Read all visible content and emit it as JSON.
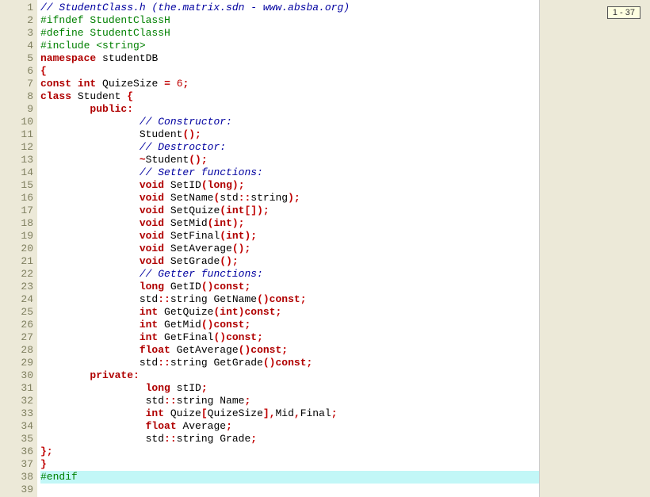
{
  "badge": "1 - 37",
  "lines": [
    {
      "n": 1,
      "hl": false,
      "tokens": [
        [
          "c-comment",
          "// StudentClass.h (the.matrix.sdn - www.absba.org)"
        ]
      ]
    },
    {
      "n": 2,
      "hl": false,
      "tokens": [
        [
          "c-pre",
          "#ifndef StudentClassH"
        ]
      ]
    },
    {
      "n": 3,
      "hl": false,
      "tokens": [
        [
          "c-pre",
          "#define StudentClassH"
        ]
      ]
    },
    {
      "n": 4,
      "hl": false,
      "tokens": [
        [
          "c-pre",
          "#include <string>"
        ]
      ]
    },
    {
      "n": 5,
      "hl": false,
      "tokens": [
        [
          "c-kw",
          "namespace"
        ],
        [
          "",
          " "
        ],
        [
          "c-ident",
          "studentDB"
        ]
      ]
    },
    {
      "n": 6,
      "hl": false,
      "tokens": [
        [
          "c-punct",
          "{"
        ]
      ]
    },
    {
      "n": 7,
      "hl": false,
      "tokens": [
        [
          "c-kw",
          "const"
        ],
        [
          "",
          " "
        ],
        [
          "c-kw",
          "int"
        ],
        [
          "",
          " QuizeSize "
        ],
        [
          "c-punct",
          "="
        ],
        [
          "",
          " "
        ],
        [
          "c-num",
          "6"
        ],
        [
          "c-punct",
          ";"
        ]
      ]
    },
    {
      "n": 8,
      "hl": false,
      "tokens": [
        [
          "c-kw",
          "class"
        ],
        [
          "",
          " Student "
        ],
        [
          "c-punct",
          "{"
        ]
      ]
    },
    {
      "n": 9,
      "hl": false,
      "tokens": [
        [
          "",
          "        "
        ],
        [
          "c-kw",
          "public"
        ],
        [
          "c-punct",
          ":"
        ]
      ]
    },
    {
      "n": 10,
      "hl": false,
      "tokens": [
        [
          "",
          "                "
        ],
        [
          "c-comment",
          "// Constructor:"
        ]
      ]
    },
    {
      "n": 11,
      "hl": false,
      "tokens": [
        [
          "",
          "                Student"
        ],
        [
          "c-punct",
          "();"
        ]
      ]
    },
    {
      "n": 12,
      "hl": false,
      "tokens": [
        [
          "",
          "                "
        ],
        [
          "c-comment",
          "// Destroctor:"
        ]
      ]
    },
    {
      "n": 13,
      "hl": false,
      "tokens": [
        [
          "",
          "                "
        ],
        [
          "c-punct",
          "~"
        ],
        [
          "",
          "Student"
        ],
        [
          "c-punct",
          "();"
        ]
      ]
    },
    {
      "n": 14,
      "hl": false,
      "tokens": [
        [
          "",
          "                "
        ],
        [
          "c-comment",
          "// Setter functions:"
        ]
      ]
    },
    {
      "n": 15,
      "hl": false,
      "tokens": [
        [
          "",
          "                "
        ],
        [
          "c-kw",
          "void"
        ],
        [
          "",
          " SetID"
        ],
        [
          "c-punct",
          "("
        ],
        [
          "c-kw",
          "long"
        ],
        [
          "c-punct",
          ");"
        ]
      ]
    },
    {
      "n": 16,
      "hl": false,
      "tokens": [
        [
          "",
          "                "
        ],
        [
          "c-kw",
          "void"
        ],
        [
          "",
          " SetName"
        ],
        [
          "c-punct",
          "("
        ],
        [
          "",
          "std"
        ],
        [
          "c-punct",
          "::"
        ],
        [
          "",
          "string"
        ],
        [
          "c-punct",
          ");"
        ]
      ]
    },
    {
      "n": 17,
      "hl": false,
      "tokens": [
        [
          "",
          "                "
        ],
        [
          "c-kw",
          "void"
        ],
        [
          "",
          " SetQuize"
        ],
        [
          "c-punct",
          "("
        ],
        [
          "c-kw",
          "int"
        ],
        [
          "c-punct",
          "[]);"
        ]
      ]
    },
    {
      "n": 18,
      "hl": false,
      "tokens": [
        [
          "",
          "                "
        ],
        [
          "c-kw",
          "void"
        ],
        [
          "",
          " SetMid"
        ],
        [
          "c-punct",
          "("
        ],
        [
          "c-kw",
          "int"
        ],
        [
          "c-punct",
          ");"
        ]
      ]
    },
    {
      "n": 19,
      "hl": false,
      "tokens": [
        [
          "",
          "                "
        ],
        [
          "c-kw",
          "void"
        ],
        [
          "",
          " SetFinal"
        ],
        [
          "c-punct",
          "("
        ],
        [
          "c-kw",
          "int"
        ],
        [
          "c-punct",
          ");"
        ]
      ]
    },
    {
      "n": 20,
      "hl": false,
      "tokens": [
        [
          "",
          "                "
        ],
        [
          "c-kw",
          "void"
        ],
        [
          "",
          " SetAverage"
        ],
        [
          "c-punct",
          "();"
        ]
      ]
    },
    {
      "n": 21,
      "hl": false,
      "tokens": [
        [
          "",
          "                "
        ],
        [
          "c-kw",
          "void"
        ],
        [
          "",
          " SetGrade"
        ],
        [
          "c-punct",
          "();"
        ]
      ]
    },
    {
      "n": 22,
      "hl": false,
      "tokens": [
        [
          "",
          "                "
        ],
        [
          "c-comment",
          "// Getter functions:"
        ]
      ]
    },
    {
      "n": 23,
      "hl": false,
      "tokens": [
        [
          "",
          "                "
        ],
        [
          "c-kw",
          "long"
        ],
        [
          "",
          " GetID"
        ],
        [
          "c-punct",
          "()"
        ],
        [
          "c-kw",
          "const"
        ],
        [
          "c-punct",
          ";"
        ]
      ]
    },
    {
      "n": 24,
      "hl": false,
      "tokens": [
        [
          "",
          "                std"
        ],
        [
          "c-punct",
          "::"
        ],
        [
          "",
          "string GetName"
        ],
        [
          "c-punct",
          "()"
        ],
        [
          "c-kw",
          "const"
        ],
        [
          "c-punct",
          ";"
        ]
      ]
    },
    {
      "n": 25,
      "hl": false,
      "tokens": [
        [
          "",
          "                "
        ],
        [
          "c-kw",
          "int"
        ],
        [
          "",
          " GetQuize"
        ],
        [
          "c-punct",
          "("
        ],
        [
          "c-kw",
          "int"
        ],
        [
          "c-punct",
          ")"
        ],
        [
          "c-kw",
          "const"
        ],
        [
          "c-punct",
          ";"
        ]
      ]
    },
    {
      "n": 26,
      "hl": false,
      "tokens": [
        [
          "",
          "                "
        ],
        [
          "c-kw",
          "int"
        ],
        [
          "",
          " GetMid"
        ],
        [
          "c-punct",
          "()"
        ],
        [
          "c-kw",
          "const"
        ],
        [
          "c-punct",
          ";"
        ]
      ]
    },
    {
      "n": 27,
      "hl": false,
      "tokens": [
        [
          "",
          "                "
        ],
        [
          "c-kw",
          "int"
        ],
        [
          "",
          " GetFinal"
        ],
        [
          "c-punct",
          "()"
        ],
        [
          "c-kw",
          "const"
        ],
        [
          "c-punct",
          ";"
        ]
      ]
    },
    {
      "n": 28,
      "hl": false,
      "tokens": [
        [
          "",
          "                "
        ],
        [
          "c-kw",
          "float"
        ],
        [
          "",
          " GetAverage"
        ],
        [
          "c-punct",
          "()"
        ],
        [
          "c-kw",
          "const"
        ],
        [
          "c-punct",
          ";"
        ]
      ]
    },
    {
      "n": 29,
      "hl": false,
      "tokens": [
        [
          "",
          "                std"
        ],
        [
          "c-punct",
          "::"
        ],
        [
          "",
          "string GetGrade"
        ],
        [
          "c-punct",
          "()"
        ],
        [
          "c-kw",
          "const"
        ],
        [
          "c-punct",
          ";"
        ]
      ]
    },
    {
      "n": 30,
      "hl": false,
      "tokens": [
        [
          "",
          "        "
        ],
        [
          "c-kw",
          "private"
        ],
        [
          "c-punct",
          ":"
        ]
      ]
    },
    {
      "n": 31,
      "hl": false,
      "tokens": [
        [
          "",
          "                 "
        ],
        [
          "c-kw",
          "long"
        ],
        [
          "",
          " stID"
        ],
        [
          "c-punct",
          ";"
        ]
      ]
    },
    {
      "n": 32,
      "hl": false,
      "tokens": [
        [
          "",
          "                 std"
        ],
        [
          "c-punct",
          "::"
        ],
        [
          "",
          "string Name"
        ],
        [
          "c-punct",
          ";"
        ]
      ]
    },
    {
      "n": 33,
      "hl": false,
      "tokens": [
        [
          "",
          "                 "
        ],
        [
          "c-kw",
          "int"
        ],
        [
          "",
          " Quize"
        ],
        [
          "c-punct",
          "["
        ],
        [
          "",
          "QuizeSize"
        ],
        [
          "c-punct",
          "],"
        ],
        [
          "",
          "Mid"
        ],
        [
          "c-punct",
          ","
        ],
        [
          "",
          "Final"
        ],
        [
          "c-punct",
          ";"
        ]
      ]
    },
    {
      "n": 34,
      "hl": false,
      "tokens": [
        [
          "",
          "                 "
        ],
        [
          "c-kw",
          "float"
        ],
        [
          "",
          " Average"
        ],
        [
          "c-punct",
          ";"
        ]
      ]
    },
    {
      "n": 35,
      "hl": false,
      "tokens": [
        [
          "",
          "                 std"
        ],
        [
          "c-punct",
          "::"
        ],
        [
          "",
          "string Grade"
        ],
        [
          "c-punct",
          ";"
        ]
      ]
    },
    {
      "n": 36,
      "hl": false,
      "tokens": [
        [
          "c-punct",
          "};"
        ]
      ]
    },
    {
      "n": 37,
      "hl": false,
      "tokens": [
        [
          "c-punct",
          "}"
        ]
      ]
    },
    {
      "n": 38,
      "hl": true,
      "tokens": [
        [
          "c-pre",
          "#endif"
        ]
      ]
    },
    {
      "n": 39,
      "hl": false,
      "tokens": [
        [
          "",
          ""
        ]
      ]
    }
  ]
}
